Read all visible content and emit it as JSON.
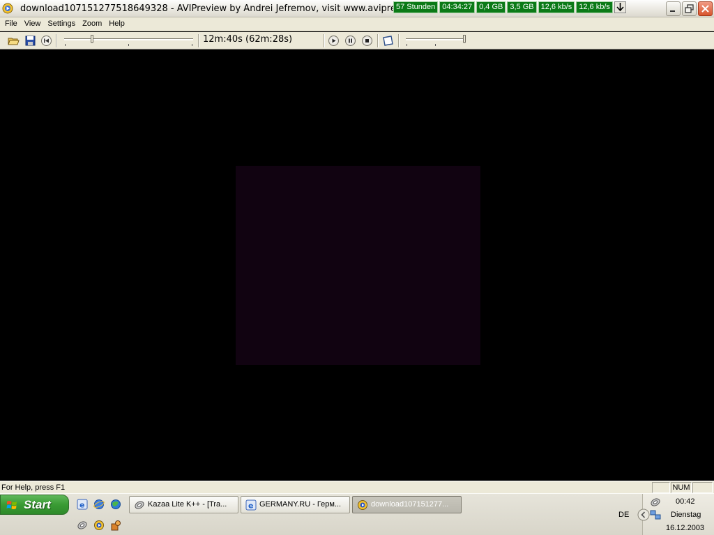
{
  "window": {
    "title": "download1071512775186493​28 - AVIPreview  by Andrei Jefremov, visit www.aviprev"
  },
  "tray_mini": [
    "57 Stunden",
    "04:34:27",
    "0,4 GB",
    "3,5 GB",
    "12,6 kb/s",
    "12,6 kb/s"
  ],
  "menu": {
    "items": [
      "File",
      "View",
      "Settings",
      "Zoom",
      "Help"
    ]
  },
  "toolbar": {
    "time_readout": "12m:40s (62m:28s)",
    "icons": [
      "open-icon",
      "save-icon",
      "rewind-icon",
      "play-icon",
      "pause-icon",
      "stop-icon",
      "fullscreen-icon"
    ]
  },
  "status": {
    "help_text": "For Help, press F1",
    "num_indicator": "NUM"
  },
  "taskbar": {
    "start_label": "Start",
    "tasks": [
      {
        "label": "Kazaa Lite K++ - [Tra...",
        "icon": "kazaa-icon"
      },
      {
        "label": "GERMANY.RU - Герм...",
        "icon": "ie-icon"
      },
      {
        "label": "download107151277...",
        "icon": "avipreview-icon"
      }
    ],
    "language": "DE",
    "clock": "00:42",
    "day": "Dienstag",
    "date": "16.12.2003"
  },
  "colors": {
    "tray_green": "#0b7a17",
    "xp_start_green": "#3a9b34",
    "video_frame": "#110311"
  }
}
